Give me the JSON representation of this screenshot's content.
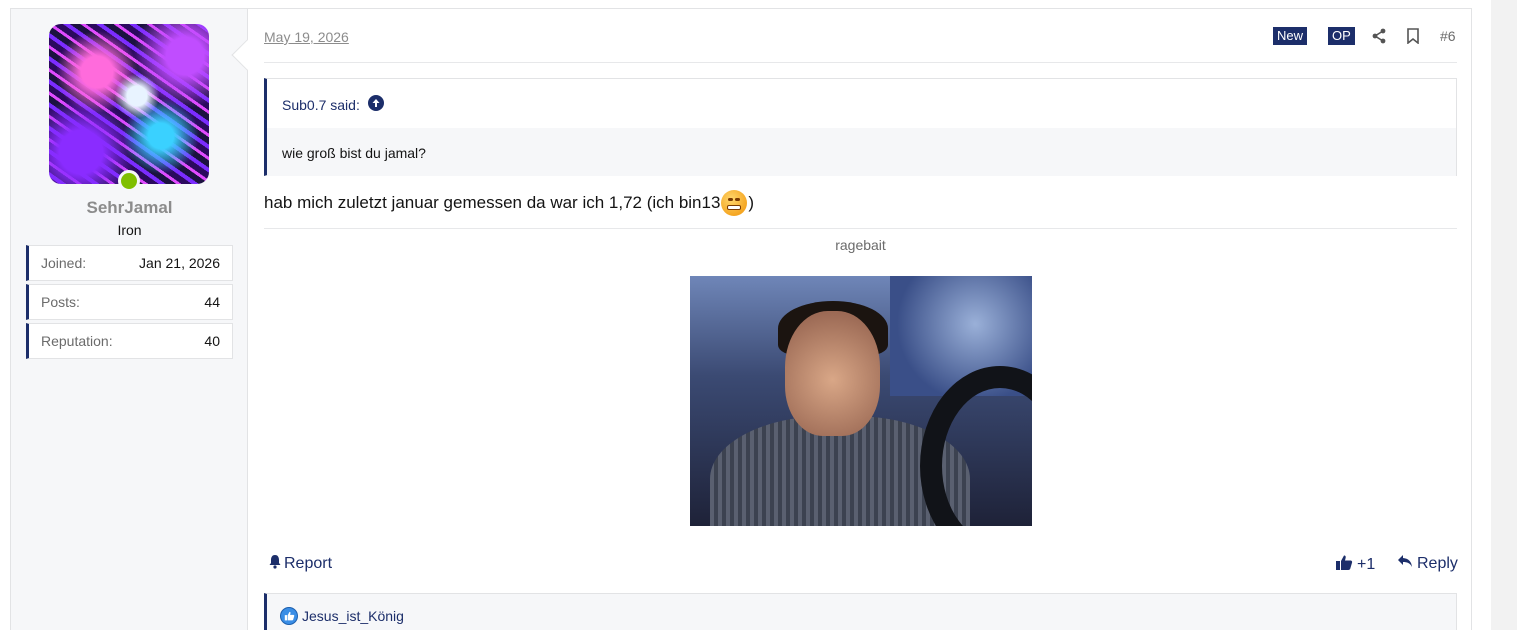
{
  "user": {
    "name": "SehrJamal",
    "title": "Iron",
    "stats": [
      {
        "label": "Joined:",
        "value": "Jan 21, 2026"
      },
      {
        "label": "Posts:",
        "value": "44"
      },
      {
        "label": "Reputation:",
        "value": "40"
      }
    ],
    "online": true
  },
  "post": {
    "date": "May 19, 2026",
    "badges": {
      "new": "New",
      "op": "OP"
    },
    "number": "#6",
    "quote": {
      "author": "Sub0.7 said:",
      "text": "wie groß bist du jamal?"
    },
    "message_before": "hab mich zuletzt januar gemessen da war ich 1,72 (ich bin13",
    "message_after": ")",
    "caption": "ragebait",
    "actions": {
      "report": "Report",
      "like_count": "+1",
      "reply": "Reply"
    },
    "reactions": {
      "user": "Jesus_ist_König"
    }
  },
  "colors": {
    "accent": "#1c2e6a",
    "online": "#7fbf00",
    "like": "#3a8ee6"
  },
  "icons": [
    "share-icon",
    "bookmark-icon",
    "arrow-up-circle-icon",
    "bell-icon",
    "thumbs-up-icon",
    "reply-icon",
    "like-reaction-icon",
    "grin-emoji"
  ]
}
